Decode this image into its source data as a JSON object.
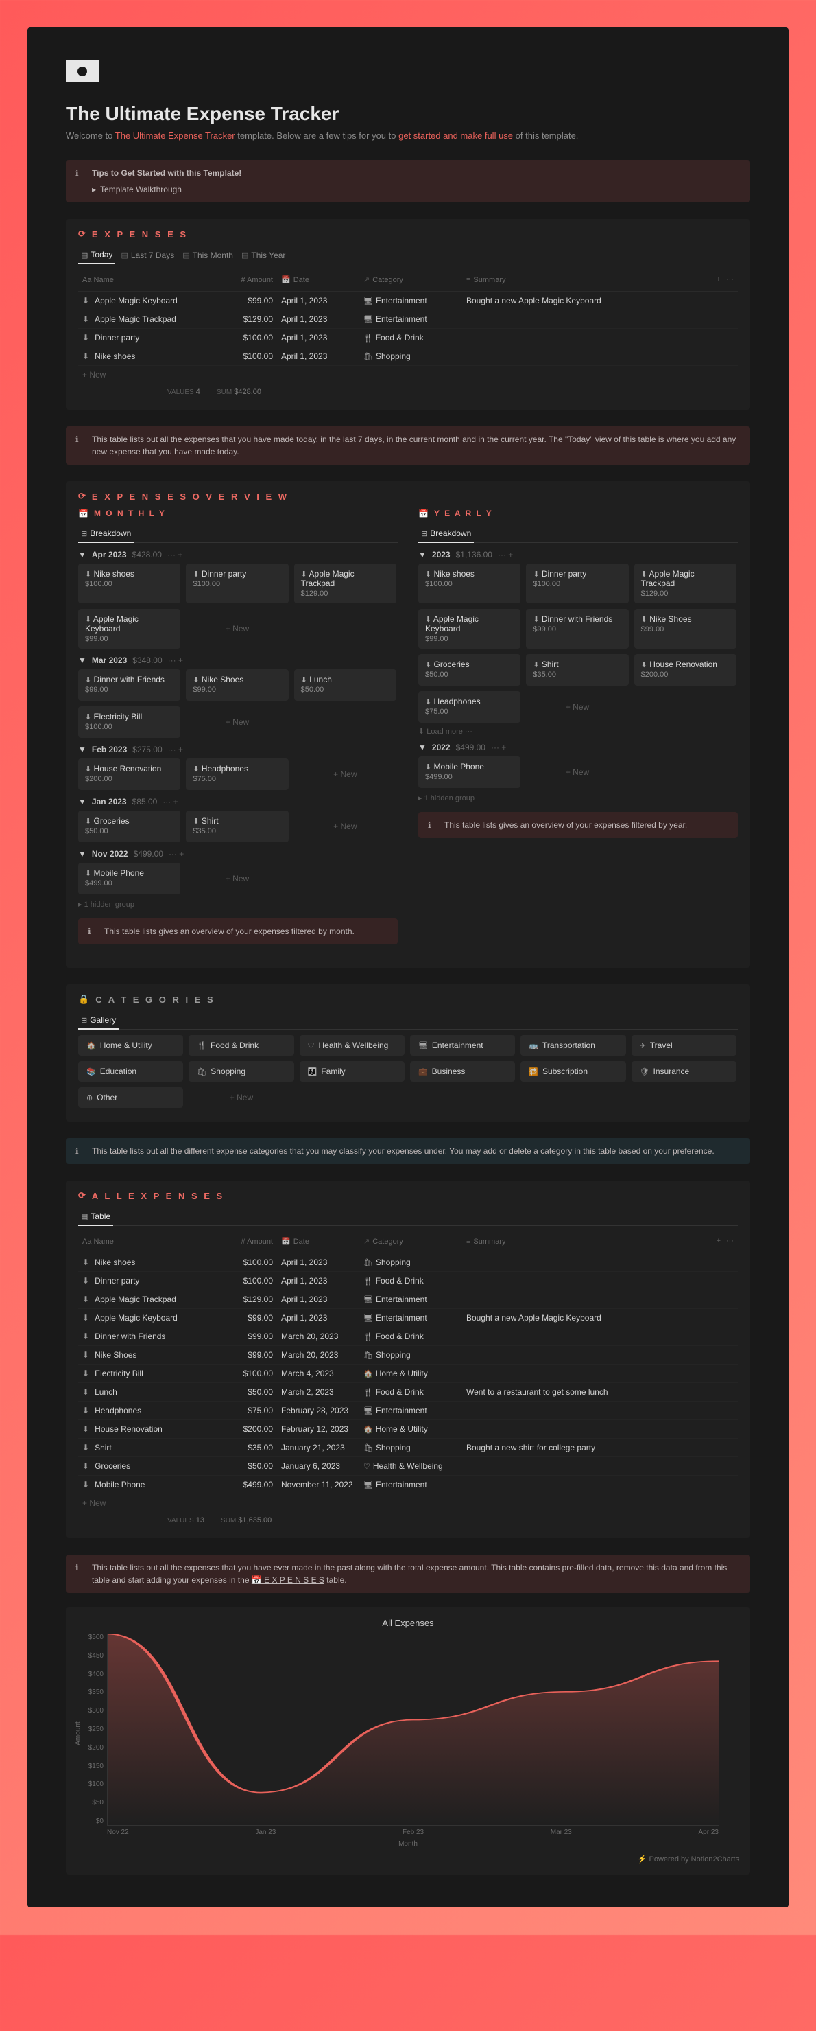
{
  "page": {
    "title": "The Ultimate Expense Tracker",
    "subtitle_prefix": "Welcome to ",
    "subtitle_accent": "The Ultimate Expense Tracker",
    "subtitle_mid": " template. Below are a few tips for you to ",
    "subtitle_accent2": "get started and make full use",
    "subtitle_suffix": " of this template."
  },
  "tips": {
    "title": "Tips to Get Started with this Template!",
    "walkthrough": "Template Walkthrough"
  },
  "expenses": {
    "title": "E X P E N S E S",
    "tabs": [
      "Today",
      "Last 7 Days",
      "This Month",
      "This Year"
    ],
    "headers": {
      "name": "Aa Name",
      "amount": "# Amount",
      "date": "Date",
      "category": "Category",
      "summary": "Summary"
    },
    "rows": [
      {
        "name": "Apple Magic Keyboard",
        "amount": "$99.00",
        "date": "April 1, 2023",
        "category": "Entertainment",
        "cat_icon": "🖥",
        "summary": "Bought a new Apple Magic Keyboard"
      },
      {
        "name": "Apple Magic Trackpad",
        "amount": "$129.00",
        "date": "April 1, 2023",
        "category": "Entertainment",
        "cat_icon": "🖥",
        "summary": ""
      },
      {
        "name": "Dinner party",
        "amount": "$100.00",
        "date": "April 1, 2023",
        "category": "Food & Drink",
        "cat_icon": "🍴",
        "summary": ""
      },
      {
        "name": "Nike shoes",
        "amount": "$100.00",
        "date": "April 1, 2023",
        "category": "Shopping",
        "cat_icon": "🛍",
        "summary": ""
      }
    ],
    "new": "+ New",
    "stats": {
      "values_label": "VALUES",
      "values": "4",
      "sum_label": "SUM",
      "sum": "$428.00"
    },
    "callout": "This table lists out all the expenses that you have made today, in the last 7 days, in the current month and in the current year. The \"Today\" view of this table is where you add any new expense that you have made today."
  },
  "overview": {
    "title": "E X P E N S E S  O V E R V I E W",
    "monthly": {
      "title": "M O N T H L Y",
      "breakdown": "Breakdown",
      "groups": [
        {
          "label": "Apr 2023",
          "total": "$428.00",
          "items": [
            {
              "name": "Nike shoes",
              "price": "$100.00"
            },
            {
              "name": "Dinner party",
              "price": "$100.00"
            },
            {
              "name": "Apple Magic Trackpad",
              "price": "$129.00"
            },
            {
              "name": "Apple Magic Keyboard",
              "price": "$99.00"
            }
          ]
        },
        {
          "label": "Mar 2023",
          "total": "$348.00",
          "items": [
            {
              "name": "Dinner with Friends",
              "price": "$99.00"
            },
            {
              "name": "Nike Shoes",
              "price": "$99.00"
            },
            {
              "name": "Lunch",
              "price": "$50.00"
            },
            {
              "name": "Electricity Bill",
              "price": "$100.00"
            }
          ]
        },
        {
          "label": "Feb 2023",
          "total": "$275.00",
          "items": [
            {
              "name": "House Renovation",
              "price": "$200.00"
            },
            {
              "name": "Headphones",
              "price": "$75.00"
            }
          ]
        },
        {
          "label": "Jan 2023",
          "total": "$85.00",
          "items": [
            {
              "name": "Groceries",
              "price": "$50.00"
            },
            {
              "name": "Shirt",
              "price": "$35.00"
            }
          ]
        },
        {
          "label": "Nov 2022",
          "total": "$499.00",
          "items": [
            {
              "name": "Mobile Phone",
              "price": "$499.00"
            }
          ]
        }
      ],
      "hidden": "1 hidden group",
      "new": "+  New",
      "callout": "This table lists gives an overview of your expenses filtered by month."
    },
    "yearly": {
      "title": "Y E A R L Y",
      "breakdown": "Breakdown",
      "groups": [
        {
          "label": "2023",
          "total": "$1,136.00",
          "items": [
            {
              "name": "Nike shoes",
              "price": "$100.00"
            },
            {
              "name": "Dinner party",
              "price": "$100.00"
            },
            {
              "name": "Apple Magic Trackpad",
              "price": "$129.00"
            },
            {
              "name": "Apple Magic Keyboard",
              "price": "$99.00"
            },
            {
              "name": "Dinner with Friends",
              "price": "$99.00"
            },
            {
              "name": "Nike Shoes",
              "price": "$99.00"
            },
            {
              "name": "Groceries",
              "price": "$50.00"
            },
            {
              "name": "Shirt",
              "price": "$35.00"
            },
            {
              "name": "House Renovation",
              "price": "$200.00"
            },
            {
              "name": "Headphones",
              "price": "$75.00"
            }
          ],
          "load_more": "Load more"
        },
        {
          "label": "2022",
          "total": "$499.00",
          "items": [
            {
              "name": "Mobile Phone",
              "price": "$499.00"
            }
          ]
        }
      ],
      "hidden": "1 hidden group",
      "new": "+  New",
      "callout": "This table lists gives an overview of your expenses filtered by year."
    }
  },
  "categories": {
    "title": "C A T E G O R I E S",
    "gallery": "Gallery",
    "items": [
      {
        "icon": "🏠",
        "name": "Home & Utility"
      },
      {
        "icon": "🍴",
        "name": "Food & Drink"
      },
      {
        "icon": "♡",
        "name": "Health & Wellbeing"
      },
      {
        "icon": "🖥",
        "name": "Entertainment"
      },
      {
        "icon": "🚌",
        "name": "Transportation"
      },
      {
        "icon": "✈",
        "name": "Travel"
      },
      {
        "icon": "📚",
        "name": "Education"
      },
      {
        "icon": "🛍",
        "name": "Shopping"
      },
      {
        "icon": "👪",
        "name": "Family"
      },
      {
        "icon": "💼",
        "name": "Business"
      },
      {
        "icon": "🔁",
        "name": "Subscription"
      },
      {
        "icon": "🛡",
        "name": "Insurance"
      },
      {
        "icon": "⊕",
        "name": "Other"
      }
    ],
    "new": "+  New",
    "callout": "This table lists out all the different expense categories that you may classify your expenses under. You may add or delete a category in this table based on your preference."
  },
  "all": {
    "title": "A L L  E X P E N S E S",
    "table": "Table",
    "headers": {
      "name": "Aa Name",
      "amount": "# Amount",
      "date": "Date",
      "category": "Category",
      "summary": "Summary"
    },
    "rows": [
      {
        "name": "Nike shoes",
        "amount": "$100.00",
        "date": "April 1, 2023",
        "cat_icon": "🛍",
        "category": "Shopping",
        "summary": ""
      },
      {
        "name": "Dinner party",
        "amount": "$100.00",
        "date": "April 1, 2023",
        "cat_icon": "🍴",
        "category": "Food & Drink",
        "summary": ""
      },
      {
        "name": "Apple Magic Trackpad",
        "amount": "$129.00",
        "date": "April 1, 2023",
        "cat_icon": "🖥",
        "category": "Entertainment",
        "summary": ""
      },
      {
        "name": "Apple Magic Keyboard",
        "amount": "$99.00",
        "date": "April 1, 2023",
        "cat_icon": "🖥",
        "category": "Entertainment",
        "summary": "Bought a new Apple Magic Keyboard"
      },
      {
        "name": "Dinner with Friends",
        "amount": "$99.00",
        "date": "March 20, 2023",
        "cat_icon": "🍴",
        "category": "Food & Drink",
        "summary": ""
      },
      {
        "name": "Nike Shoes",
        "amount": "$99.00",
        "date": "March 20, 2023",
        "cat_icon": "🛍",
        "category": "Shopping",
        "summary": ""
      },
      {
        "name": "Electricity Bill",
        "amount": "$100.00",
        "date": "March 4, 2023",
        "cat_icon": "🏠",
        "category": "Home & Utility",
        "summary": ""
      },
      {
        "name": "Lunch",
        "amount": "$50.00",
        "date": "March 2, 2023",
        "cat_icon": "🍴",
        "category": "Food & Drink",
        "summary": "Went to a restaurant to get some lunch"
      },
      {
        "name": "Headphones",
        "amount": "$75.00",
        "date": "February 28, 2023",
        "cat_icon": "🖥",
        "category": "Entertainment",
        "summary": ""
      },
      {
        "name": "House Renovation",
        "amount": "$200.00",
        "date": "February 12, 2023",
        "cat_icon": "🏠",
        "category": "Home & Utility",
        "summary": ""
      },
      {
        "name": "Shirt",
        "amount": "$35.00",
        "date": "January 21, 2023",
        "cat_icon": "🛍",
        "category": "Shopping",
        "summary": "Bought a new shirt for college party"
      },
      {
        "name": "Groceries",
        "amount": "$50.00",
        "date": "January 6, 2023",
        "cat_icon": "♡",
        "category": "Health & Wellbeing",
        "summary": ""
      },
      {
        "name": "Mobile Phone",
        "amount": "$499.00",
        "date": "November 11, 2022",
        "cat_icon": "🖥",
        "category": "Entertainment",
        "summary": ""
      }
    ],
    "new": "+ New",
    "stats": {
      "values_label": "VALUES",
      "values": "13",
      "sum_label": "SUM",
      "sum": "$1,635.00"
    },
    "callout_prefix": "This table lists out all the expenses that you have ever made in the past along with the total expense amount. This table contains pre-filled data, remove this data and from this table and start adding your expenses in the ",
    "callout_link": "📅 E X P E N S E S",
    "callout_suffix": "  table."
  },
  "chart_data": {
    "type": "line",
    "title": "All Expenses",
    "xlabel": "Month",
    "ylabel": "Amount",
    "categories": [
      "Nov 22",
      "Jan 23",
      "Feb 23",
      "Mar 23",
      "Apr 23"
    ],
    "values": [
      499,
      85,
      275,
      348,
      428
    ],
    "ylim": [
      0,
      500
    ],
    "y_ticks": [
      "$500",
      "$450",
      "$400",
      "$350",
      "$300",
      "$250",
      "$200",
      "$150",
      "$100",
      "$50",
      "$0"
    ]
  },
  "chart_footer": "⚡ Powered by Notion2Charts"
}
